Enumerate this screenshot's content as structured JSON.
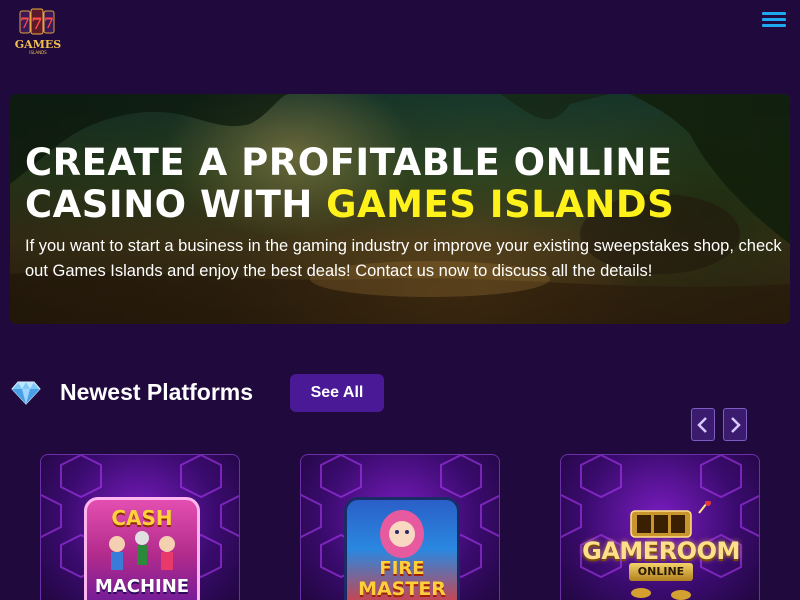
{
  "header": {
    "logo_alt": "777 Games Islands",
    "menu_icon": "hamburger-menu-icon"
  },
  "hero": {
    "title_line1": "CREATE A PROFITABLE ONLINE",
    "title_line2_prefix": "CASINO WITH ",
    "title_highlight": "GAMES ISLANDS",
    "description": "If you want to start a business in the gaming industry or improve your existing sweepstakes shop, check out Games Islands and enjoy the best deals! Contact us now to discuss all the details!",
    "highlight_color": "#fff21a"
  },
  "platforms": {
    "icon": "diamond-icon",
    "title": "Newest Platforms",
    "see_all_label": "See All",
    "prev_icon": "chevron-left-icon",
    "next_icon": "chevron-right-icon",
    "cards": [
      {
        "name": "Cash Machine",
        "line1": "CASH",
        "line2": "MACHINE"
      },
      {
        "name": "Fire Master",
        "line1": "FIRE",
        "line2": "MASTER"
      },
      {
        "name": "Gameroom Online",
        "line1": "GAMEROOM",
        "line2": "ONLINE"
      }
    ]
  },
  "colors": {
    "background": "#200a3d",
    "accent": "#4a1a96",
    "menu_icon": "#1ea8f0"
  }
}
